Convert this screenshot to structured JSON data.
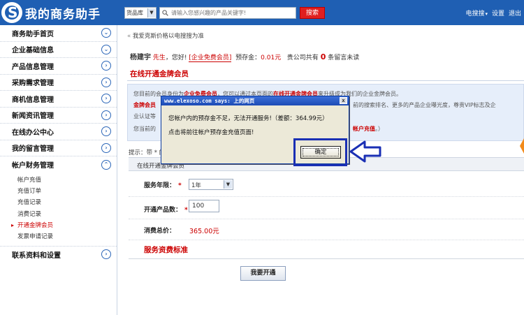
{
  "header": {
    "logo_text": "我的商务助手",
    "search_category": "货品库",
    "search_placeholder": "请输入您感兴趣的产品关键字!",
    "search_button": "搜索",
    "links": [
      "电搜搜",
      "设置",
      "退出"
    ]
  },
  "sidebar": {
    "items": [
      {
        "label": "商务助手首页"
      },
      {
        "label": "企业基础信息"
      },
      {
        "label": "产品信息管理"
      },
      {
        "label": "采购需求管理"
      },
      {
        "label": "商机信息管理"
      },
      {
        "label": "新闻资讯管理"
      },
      {
        "label": "在线办公中心"
      },
      {
        "label": "我的留言管理"
      },
      {
        "label": "帐户财务管理"
      }
    ],
    "subitems": [
      "帐户充值",
      "充值订单",
      "充值记录",
      "消费记录",
      "开通金牌会员",
      "发票申请记录"
    ],
    "active_subitem": "开通金牌会员",
    "last_item": "联系资料和设置"
  },
  "main": {
    "breadcrumb": "我爱克斯价格以电搜搜为准",
    "user": {
      "name": "杨建宇",
      "honorific": "先生",
      "greeting": "，您好!",
      "member_type": "[企业免费会员]",
      "balance_label": "预存金：",
      "balance": "0.01元",
      "msg_prefix": "贵公司共有",
      "msg_count": "0",
      "msg_suffix": "条留言未读"
    },
    "section_title": "在线开通金牌会员",
    "info": {
      "line1_a": "您目前的会员身份为",
      "line1_b": "企业免费会员",
      "line1_c": "，您可以通过本页面的",
      "line1_d": "在线开通金牌会员",
      "line1_e": "来升级成为我们的企业金牌会员。",
      "line2_a": "金牌会员",
      "line2_b": "前的搜索排名、更多的产品企业曝光度，尊贵VIP标志及企",
      "line3": "业认证等",
      "line4_a": "您当前的",
      "line4_b": "帐户充值",
      "line4_c": "。）"
    },
    "prompt": "提示：带 * 的为必填项",
    "form_header": "在线开通金牌会员",
    "form": {
      "years_label": "服务年限：",
      "years_value": "1年",
      "count_label": "开通产品数：",
      "count_value": "100",
      "total_label": "消费总价：",
      "total_value": "365.00元",
      "standard_title": "服务资费标准"
    },
    "submit_button": "我要开通"
  },
  "dialog": {
    "title": "www.elexoso.com says: 上的网页",
    "close": "x",
    "message1": "您帐户内的预存金不足，无法开通服务!（差额：364.99元）",
    "message2": "点击将前往帐户预存金充值页面!",
    "ok_button": "确定"
  },
  "colors": {
    "header_blue": "#1f5fb3",
    "alert_red": "#cc0000",
    "highlight_frame": "#1a2fb4",
    "orange_marker": "#f28a1a"
  }
}
